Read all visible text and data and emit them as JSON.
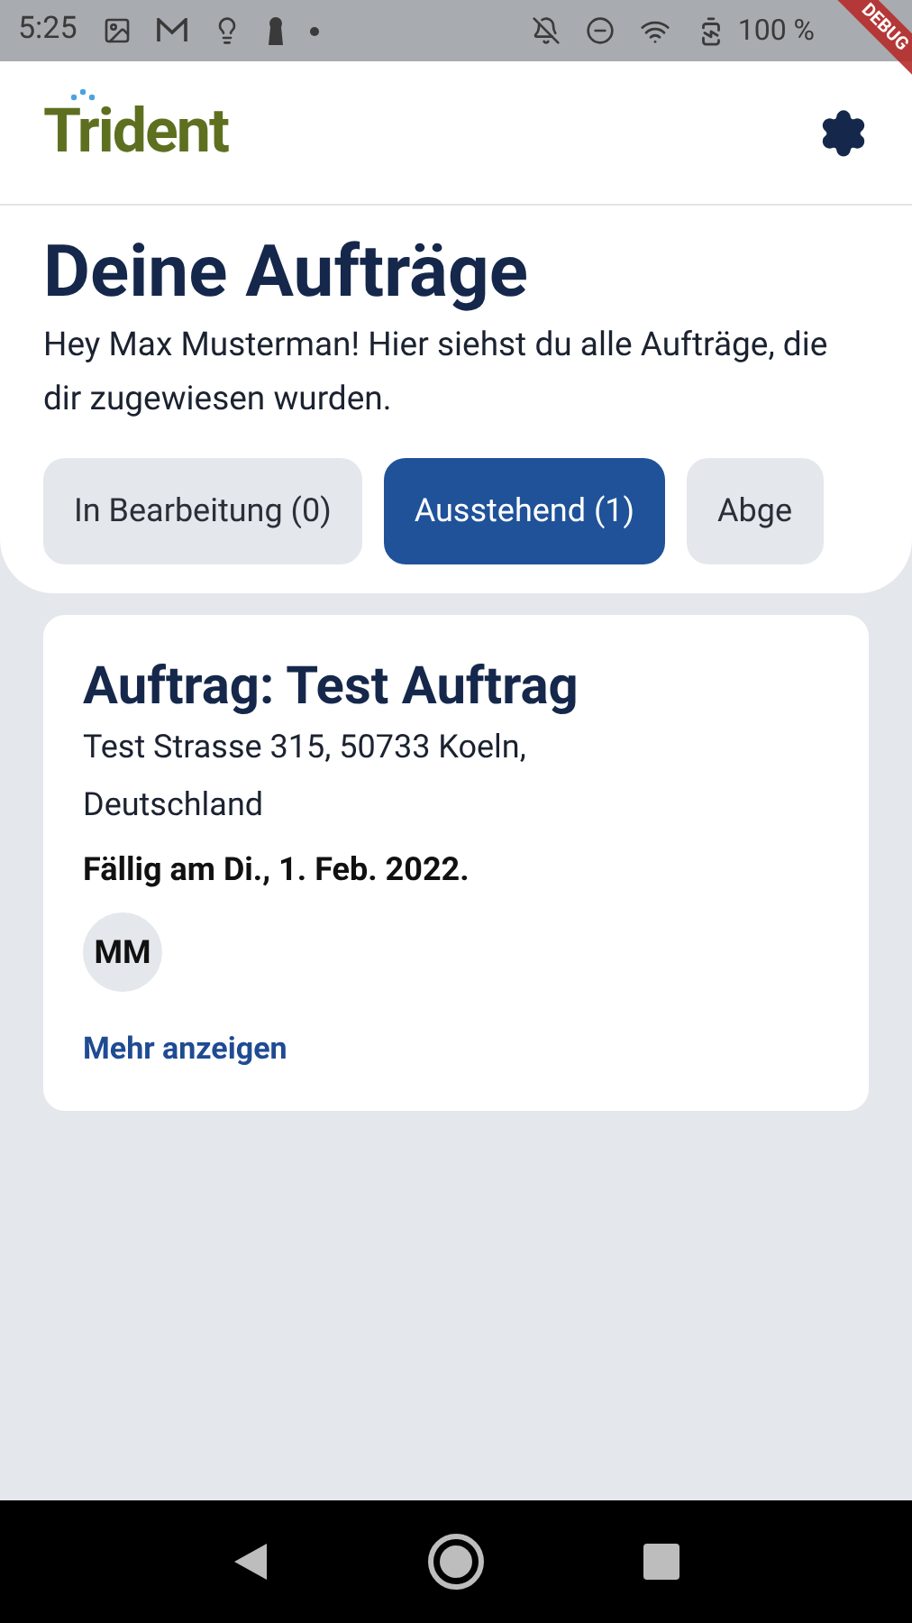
{
  "status_bar": {
    "time": "5:25",
    "battery": "100 %"
  },
  "debug_banner": "DEBUG",
  "app_bar": {
    "logo": "Trident"
  },
  "header": {
    "title": "Deine Aufträge",
    "subtitle": "Hey Max Musterman! Hier siehst du alle Aufträge, die dir zugewiesen wurden."
  },
  "tabs": [
    {
      "label": "In Bearbeitung (0)",
      "selected": false
    },
    {
      "label": "Ausstehend (1)",
      "selected": true
    },
    {
      "label": "Abge",
      "selected": false
    }
  ],
  "orders": [
    {
      "title": "Auftrag: Test Auftrag",
      "address": "Test Strasse 315, 50733 Koeln, Deutschland",
      "due": "Fällig am Di., 1. Feb. 2022.",
      "assignees": [
        "MM"
      ],
      "link": "Mehr anzeigen"
    }
  ]
}
